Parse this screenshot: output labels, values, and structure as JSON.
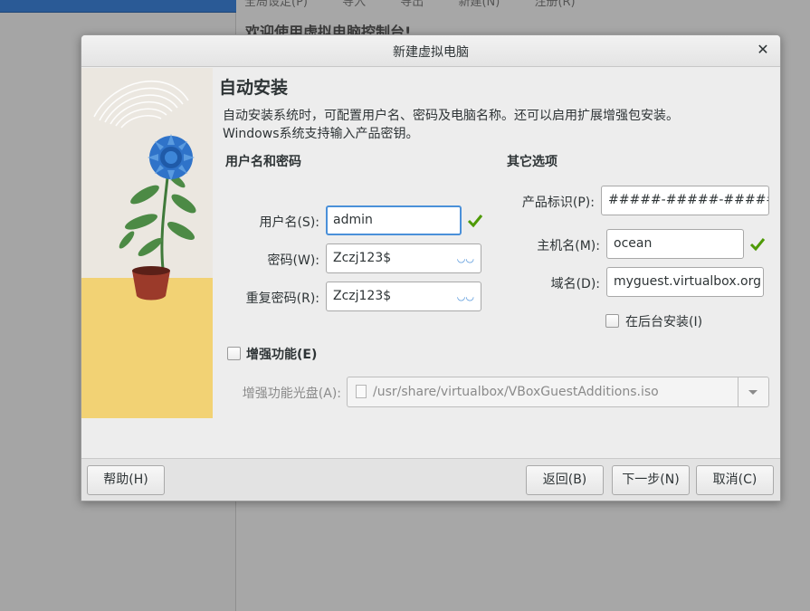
{
  "background": {
    "menu": [
      "全局设定(P)",
      "导入",
      "导出",
      "新建(N)",
      "注册(R)"
    ],
    "welcome": "欢迎使用虚拟电脑控制台!"
  },
  "dialog": {
    "title": "新建虚拟电脑",
    "heading": "自动安装",
    "description": "自动安装系统时，可配置用户名、密码及电脑名称。还可以启用扩展增强包安装。Windows系统支持输入产品密钥。",
    "credentials": {
      "section_title": "用户名和密码",
      "username_label": "用户名(S):",
      "username_value": "admin",
      "password_label": "密码(W):",
      "password_value": "Zczj123$",
      "repeat_label": "重复密码(R):",
      "repeat_value": "Zczj123$"
    },
    "other": {
      "section_title": "其它选项",
      "product_key_label": "产品标识(P):",
      "product_key_value": "#####-#####-#####-",
      "hostname_label": "主机名(M):",
      "hostname_value": "ocean",
      "domain_label": "域名(D):",
      "domain_value": "myguest.virtualbox.org",
      "background_install_label": "在后台安装(I)"
    },
    "guest_additions": {
      "checkbox_label": "增强功能(E)",
      "iso_label": "增强功能光盘(A):",
      "iso_path": "/usr/share/virtualbox/VBoxGuestAdditions.iso"
    },
    "buttons": {
      "help": "帮助(H)",
      "back": "返回(B)",
      "next": "下一步(N)",
      "cancel": "取消(C)"
    }
  },
  "colors": {
    "accent": "#4a90d9",
    "valid_check": "#4e9a06",
    "art_yellow": "#f2d274",
    "flower_blue": "#2f73c9",
    "pot": "#9b3a2a"
  }
}
